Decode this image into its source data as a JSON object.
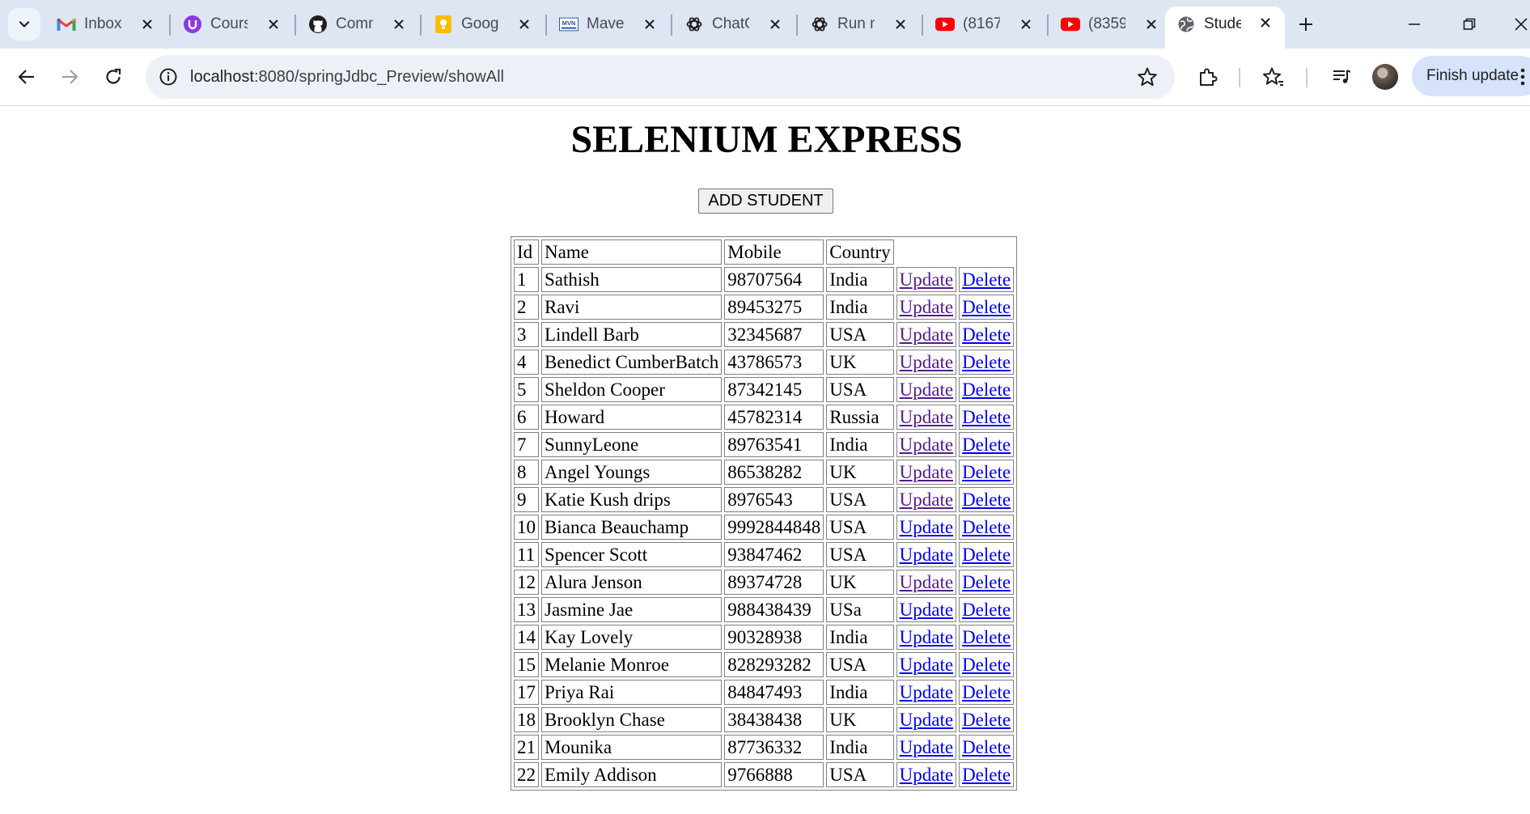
{
  "browser": {
    "tabs": [
      {
        "title": "Inbox",
        "icon": "gmail-icon"
      },
      {
        "title": "Cours",
        "icon": "course-icon"
      },
      {
        "title": "Comm",
        "icon": "github-icon"
      },
      {
        "title": "Googl",
        "icon": "google-keep-icon"
      },
      {
        "title": "Maver",
        "icon": "maven-icon"
      },
      {
        "title": "ChatG",
        "icon": "chatgpt-icon"
      },
      {
        "title": "Run n",
        "icon": "chatgpt-icon"
      },
      {
        "title": "(8167",
        "icon": "youtube-icon"
      },
      {
        "title": "(8359",
        "icon": "youtube-icon"
      },
      {
        "title": "Stude",
        "icon": "globe-icon",
        "active": true
      }
    ],
    "maven_badge": "MVN",
    "address": {
      "host": "localhost",
      "path": ":8080/springJdbc_Preview/showAll"
    },
    "finish_update_label": "Finish update",
    "colors": {
      "tabstrip": "#dfe6f3",
      "omnibox": "#edf1f7",
      "finish_button": "#d7e3fb"
    }
  },
  "page": {
    "heading": "SELENIUM EXPRESS",
    "add_button": "ADD STUDENT",
    "table": {
      "headers": [
        "Id",
        "Name",
        "Mobile",
        "Country"
      ],
      "update_label": "Update",
      "delete_label": "Delete",
      "rows": [
        {
          "id": "1",
          "name": "Sathish",
          "mobile": "98707564",
          "country": "India",
          "update_visited": true
        },
        {
          "id": "2",
          "name": "Ravi",
          "mobile": "89453275",
          "country": "India",
          "update_visited": true
        },
        {
          "id": "3",
          "name": "Lindell Barb",
          "mobile": "32345687",
          "country": "USA",
          "update_visited": true
        },
        {
          "id": "4",
          "name": "Benedict CumberBatch",
          "mobile": "43786573",
          "country": "UK",
          "update_visited": true
        },
        {
          "id": "5",
          "name": "Sheldon Cooper",
          "mobile": "87342145",
          "country": "USA",
          "update_visited": true
        },
        {
          "id": "6",
          "name": "Howard",
          "mobile": "45782314",
          "country": "Russia",
          "update_visited": true
        },
        {
          "id": "7",
          "name": "SunnyLeone",
          "mobile": "89763541",
          "country": "India",
          "update_visited": true
        },
        {
          "id": "8",
          "name": "Angel Youngs",
          "mobile": "86538282",
          "country": "UK",
          "update_visited": true
        },
        {
          "id": "9",
          "name": "Katie Kush drips",
          "mobile": "8976543",
          "country": "USA",
          "update_visited": true
        },
        {
          "id": "10",
          "name": "Bianca Beauchamp",
          "mobile": "9992844848",
          "country": "USA",
          "update_visited": false
        },
        {
          "id": "11",
          "name": "Spencer Scott",
          "mobile": "93847462",
          "country": "USA",
          "update_visited": false
        },
        {
          "id": "12",
          "name": "Alura Jenson",
          "mobile": "89374728",
          "country": "UK",
          "update_visited": true
        },
        {
          "id": "13",
          "name": "Jasmine Jae",
          "mobile": "988438439",
          "country": "USa",
          "update_visited": false
        },
        {
          "id": "14",
          "name": "Kay Lovely",
          "mobile": "90328938",
          "country": "India",
          "update_visited": false
        },
        {
          "id": "15",
          "name": "Melanie Monroe",
          "mobile": "828293282",
          "country": "USA",
          "update_visited": false
        },
        {
          "id": "17",
          "name": "Priya Rai",
          "mobile": "84847493",
          "country": "India",
          "update_visited": false
        },
        {
          "id": "18",
          "name": "Brooklyn Chase",
          "mobile": "38438438",
          "country": "UK",
          "update_visited": false
        },
        {
          "id": "21",
          "name": "Mounika",
          "mobile": "87736332",
          "country": "India",
          "update_visited": false
        },
        {
          "id": "22",
          "name": "Emily Addison",
          "mobile": "9766888",
          "country": "USA",
          "update_visited": false
        }
      ]
    },
    "colors": {
      "link": "#0000ee",
      "visited_link": "#551a8b"
    }
  }
}
